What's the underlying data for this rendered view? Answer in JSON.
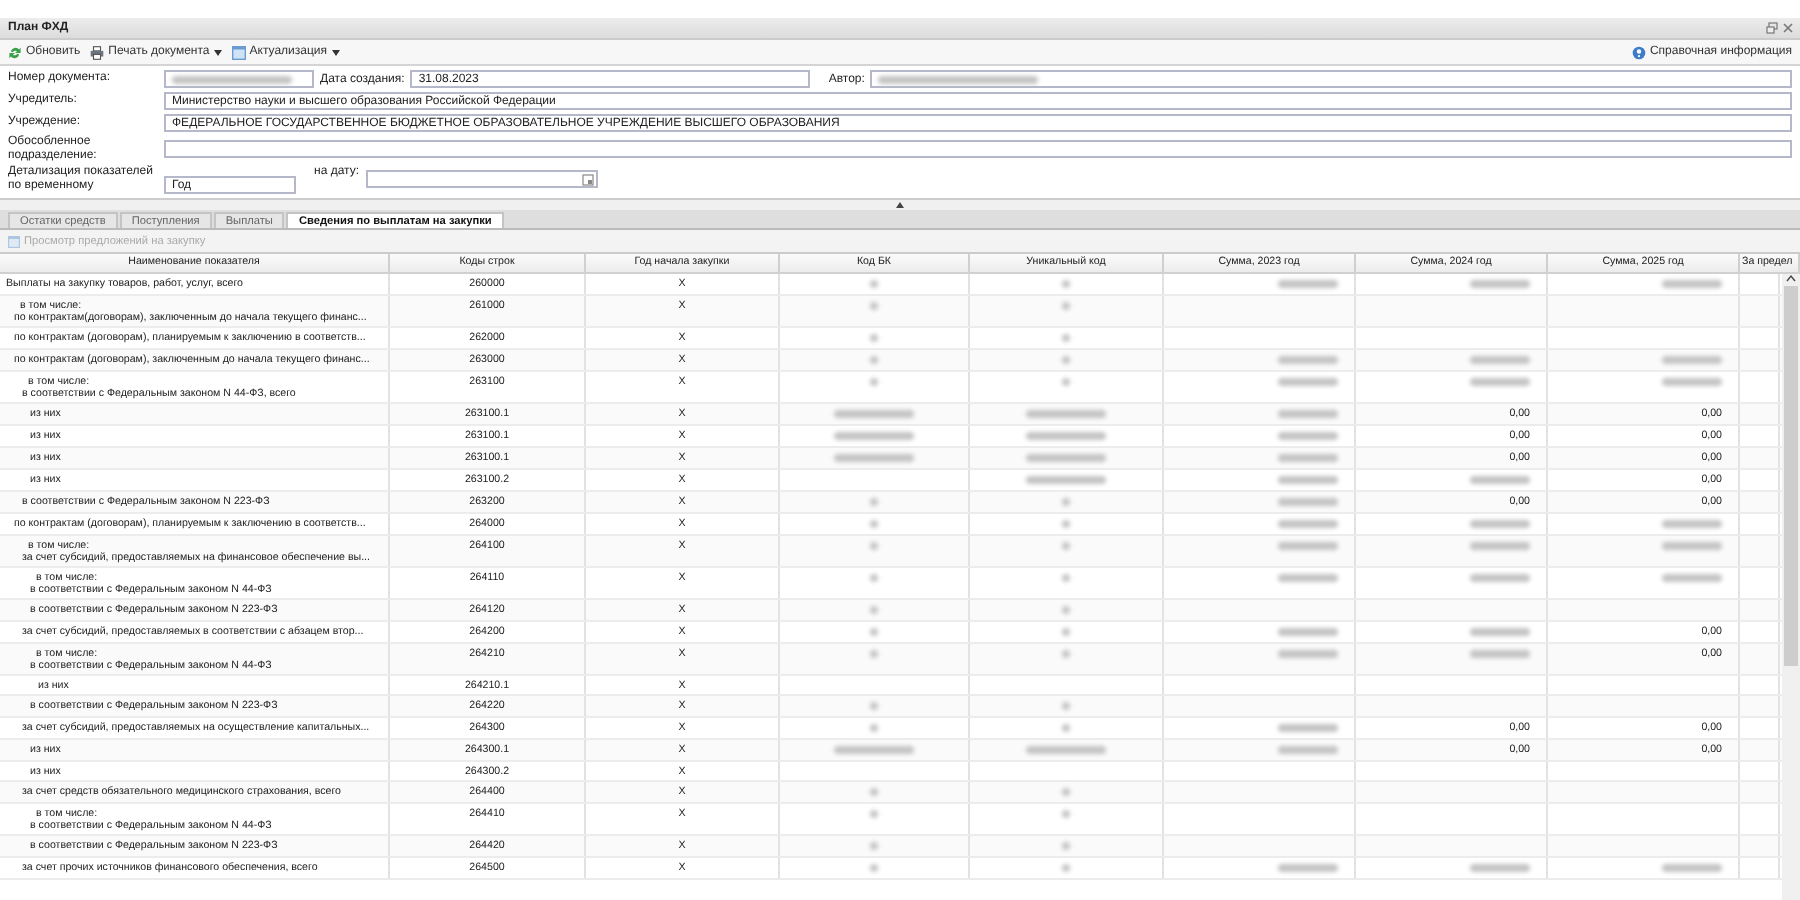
{
  "window": {
    "title": "План ФХД"
  },
  "toolbar": {
    "left": [
      {
        "label": "Обновить",
        "dropdown": false
      },
      {
        "label": "Печать документа",
        "dropdown": true
      },
      {
        "label": "Актуализация",
        "dropdown": true
      }
    ],
    "right": {
      "label": "Справочная информация"
    }
  },
  "form": {
    "document_number": {
      "label": "Номер документа:",
      "blurred": true
    },
    "created": {
      "label": "Дата создания:",
      "value": "31.08.2023"
    },
    "author": {
      "label": "Автор:",
      "blurred": true
    },
    "founder": {
      "label": "Учредитель:",
      "value": "Министерство науки и высшего образования Российской Федерации"
    },
    "institution": {
      "label": "Учреждение:",
      "value": "ФЕДЕРАЛЬНОЕ ГОСУДАРСТВЕННОЕ БЮДЖЕТНОЕ ОБРАЗОВАТЕЛЬНОЕ УЧРЕЖДЕНИЕ ВЫСШЕГО ОБРАЗОВАНИЯ"
    },
    "subdivision": {
      "label": "Обособленное подразделение:"
    },
    "detail": {
      "label": "Детализация показателей по временному",
      "value": "Год"
    },
    "on_date": {
      "label": "на дату:"
    }
  },
  "tabs": [
    {
      "label": "Остатки средств",
      "selected": false
    },
    {
      "label": "Поступления",
      "selected": false
    },
    {
      "label": "Выплаты",
      "selected": false
    },
    {
      "label": "Сведения по выплатам на закупки",
      "selected": true
    }
  ],
  "subtoolbar": {
    "label": "Просмотр предложений на закупку",
    "disabled": true
  },
  "table": {
    "columns": [
      "Наименование показателя",
      "Коды строк",
      "Год начала закупки",
      "Код БК",
      "Уникальный код",
      "Сумма, 2023 год",
      "Сумма, 2024 год",
      "Сумма, 2025 год",
      "За предел"
    ],
    "rows": [
      {
        "name": "Выплаты на закупку товаров, работ, услуг, всего",
        "code": "260000",
        "year": "X",
        "blurred": {
          "bk": true,
          "unique": true,
          "sum_2023": true,
          "sum_2024": true,
          "sum_2025": true
        },
        "children": [
          {
            "prefix": "в том числе:",
            "name": "по контрактам(договорам), заключенным до начала текущего финанс...",
            "code": "261000",
            "year": "X",
            "blurred": {
              "bk": true,
              "unique": true
            }
          },
          {
            "name": "по контрактам (договорам), планируемым к заключению в соответств...",
            "code": "262000",
            "year": "X",
            "blurred": {
              "bk": true,
              "unique": true
            }
          },
          {
            "name": "по контрактам (договорам), заключенным до начала текущего финанс...",
            "code": "263000",
            "year": "X",
            "blurred": {
              "bk": true,
              "unique": true,
              "sum_2023": true,
              "sum_2024": true,
              "sum_2025": true
            },
            "children": [
              {
                "prefix": "в том числе:",
                "name": "в соответствии с Федеральным законом N 44-ФЗ, всего",
                "code": "263100",
                "year": "X",
                "blurred": {
                  "bk": true,
                  "unique": true,
                  "sum_2023": true,
                  "sum_2024": true,
                  "sum_2025": true
                },
                "children": [
                  {
                    "name": "из них",
                    "code": "263100.1",
                    "year": "X",
                    "long_codes": true,
                    "blurred": {
                      "bk": true,
                      "unique": true,
                      "sum_2023": true
                    },
                    "sum_2024": "0,00",
                    "sum_2025": "0,00"
                  },
                  {
                    "name": "из них",
                    "code": "263100.1",
                    "year": "X",
                    "long_codes": true,
                    "blurred": {
                      "bk": true,
                      "unique": true,
                      "sum_2023": true
                    },
                    "sum_2024": "0,00",
                    "sum_2025": "0,00"
                  },
                  {
                    "name": "из них",
                    "code": "263100.1",
                    "year": "X",
                    "long_codes": true,
                    "blurred": {
                      "bk": true,
                      "unique": true,
                      "sum_2023": true
                    },
                    "sum_2024": "0,00",
                    "sum_2025": "0,00"
                  },
                  {
                    "name": "из них",
                    "code": "263100.2",
                    "year": "X",
                    "long_codes": true,
                    "blurred": {
                      "unique": true,
                      "sum_2023": true,
                      "sum_2024": true
                    },
                    "sum_2025": "0,00"
                  }
                ]
              },
              {
                "name": "в соответствии с Федеральным законом N 223-ФЗ",
                "code": "263200",
                "year": "X",
                "blurred": {
                  "bk": true,
                  "unique": true,
                  "sum_2023": true
                },
                "sum_2024": "0,00",
                "sum_2025": "0,00"
              }
            ]
          },
          {
            "name": "по контрактам (договорам), планируемым к заключению в соответств...",
            "code": "264000",
            "year": "X",
            "blurred": {
              "bk": true,
              "unique": true,
              "sum_2023": true,
              "sum_2024": true,
              "sum_2025": true
            },
            "children": [
              {
                "prefix": "в том числе:",
                "name": "за счет субсидий, предоставляемых на финансовое обеспечение вы...",
                "code": "264100",
                "year": "X",
                "blurred": {
                  "bk": true,
                  "unique": true,
                  "sum_2023": true,
                  "sum_2024": true,
                  "sum_2025": true
                },
                "children": [
                  {
                    "prefix": "в том числе:",
                    "name": "в соответствии с Федеральным законом N 44-ФЗ",
                    "code": "264110",
                    "year": "X",
                    "blurred": {
                      "bk": true,
                      "unique": true,
                      "sum_2023": true,
                      "sum_2024": true,
                      "sum_2025": true
                    }
                  },
                  {
                    "name": "в соответствии с Федеральным законом N 223-ФЗ",
                    "code": "264120",
                    "year": "X",
                    "blurred": {
                      "bk": true,
                      "unique": true
                    }
                  }
                ]
              },
              {
                "name": "за счет субсидий, предоставляемых в соответствии с абзацем втор...",
                "code": "264200",
                "year": "X",
                "blurred": {
                  "bk": true,
                  "unique": true,
                  "sum_2023": true,
                  "sum_2024": true
                },
                "sum_2025": "0,00",
                "children": [
                  {
                    "prefix": "в том числе:",
                    "name": "в соответствии с Федеральным законом N 44-ФЗ",
                    "code": "264210",
                    "year": "X",
                    "blurred": {
                      "bk": true,
                      "unique": true,
                      "sum_2023": true,
                      "sum_2024": true
                    },
                    "sum_2025": "0,00",
                    "children": [
                      {
                        "name": "из них",
                        "code": "264210.1",
                        "year": "X"
                      }
                    ]
                  },
                  {
                    "name": "в соответствии с Федеральным законом N 223-ФЗ",
                    "code": "264220",
                    "year": "X",
                    "blurred": {
                      "bk": true,
                      "unique": true
                    }
                  }
                ]
              },
              {
                "name": "за счет субсидий, предоставляемых на осуществление капитальных...",
                "code": "264300",
                "year": "X",
                "blurred": {
                  "bk": true,
                  "unique": true,
                  "sum_2023": true
                },
                "sum_2024": "0,00",
                "sum_2025": "0,00",
                "children": [
                  {
                    "name": "из них",
                    "code": "264300.1",
                    "year": "X",
                    "long_codes": true,
                    "blurred": {
                      "bk": true,
                      "unique": true,
                      "sum_2023": true
                    },
                    "sum_2024": "0,00",
                    "sum_2025": "0,00"
                  },
                  {
                    "name": "из них",
                    "code": "264300.2",
                    "year": "X"
                  }
                ]
              },
              {
                "name": "за счет средств обязательного медицинского страхования, всего",
                "code": "264400",
                "year": "X",
                "blurred": {
                  "bk": true,
                  "unique": true
                },
                "children": [
                  {
                    "prefix": "в том числе:",
                    "name": "в соответствии с Федеральным законом N 44-ФЗ",
                    "code": "264410",
                    "year": "X",
                    "blurred": {
                      "bk": true,
                      "unique": true
                    }
                  },
                  {
                    "name": "в соответствии с Федеральным законом N 223-ФЗ",
                    "code": "264420",
                    "year": "X",
                    "blurred": {
                      "bk": true,
                      "unique": true
                    }
                  }
                ]
              },
              {
                "name": "за счет прочих источников финансового обеспечения, всего",
                "code": "264500",
                "year": "X",
                "blurred": {
                  "bk": true,
                  "unique": true,
                  "sum_2023": true,
                  "sum_2024": true,
                  "sum_2025": true
                }
              }
            ]
          }
        ]
      }
    ]
  }
}
